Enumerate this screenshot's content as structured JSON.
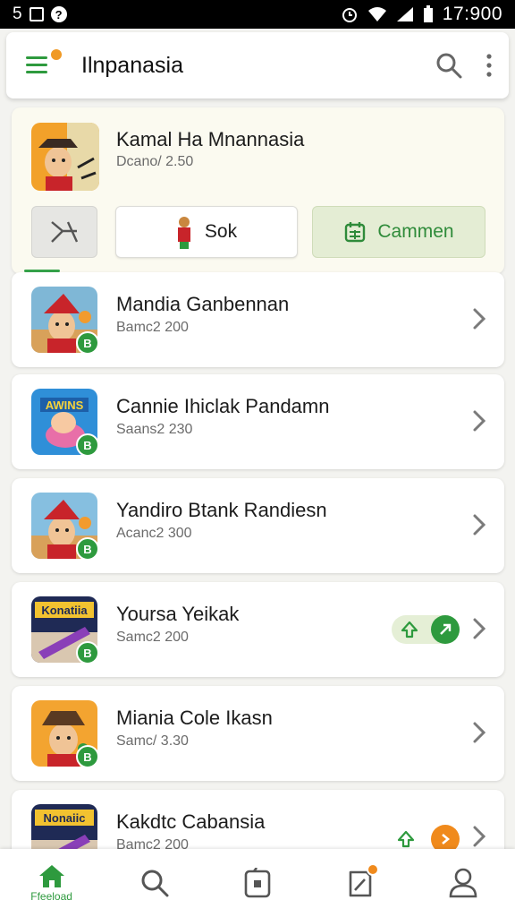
{
  "status_bar": {
    "left_text": "5",
    "help_glyph": "?",
    "time": "17:900"
  },
  "app_bar": {
    "title": "Ilnpanasia",
    "icons": [
      "menu-icon",
      "search-icon",
      "more-vert-icon"
    ],
    "accent": "#2e9a3e",
    "notification_color": "#f09a25"
  },
  "featured": {
    "name": "Kamal Ha Mnannasia",
    "subtitle": "Dcano/ 2.50",
    "buttons": {
      "share_icon": "share-icon",
      "sok_label": "Sok",
      "cammen_label": "Cammen"
    }
  },
  "list": [
    {
      "name": "Mandia Ganbennan",
      "subtitle": "Bamc2 200",
      "thumb": "red-hat"
    },
    {
      "name": "Cannie Ihiclak Pandamn",
      "subtitle": "Saans2 230",
      "thumb": "cartoon",
      "thumb_text": "AWINS"
    },
    {
      "name": "Yandiro Btank Randiesn",
      "subtitle": "Acanc2 300",
      "thumb": "red-hat"
    },
    {
      "name": "Yoursa Yeikak",
      "subtitle": "Samc2 200",
      "thumb": "game",
      "thumb_text": "Konatiia"
    },
    {
      "name": "Miania Cole Ikasn",
      "subtitle": "Samc/ 3.30",
      "thumb": "brown-hat"
    },
    {
      "name": "Kakdtc Cabansia",
      "subtitle": "Bamc2 200",
      "thumb": "game",
      "thumb_text": "Nonaiic"
    }
  ],
  "bottom_nav": {
    "home_label": "Ffeeload",
    "active_color": "#2e9a3e"
  }
}
